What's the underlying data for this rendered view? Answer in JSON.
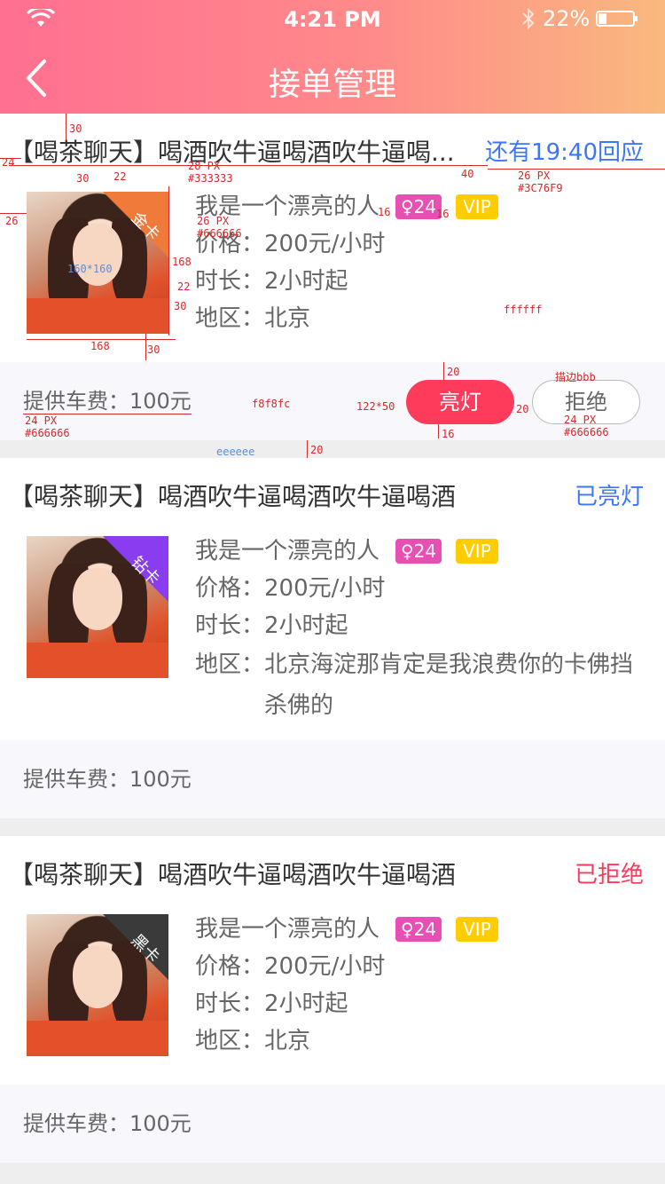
{
  "status_bar": {
    "time": "4:21 PM",
    "battery": "22%",
    "icons": [
      "wifi-icon",
      "bluetooth-icon",
      "battery-icon"
    ]
  },
  "nav": {
    "title": "接单管理",
    "back_icon": "back-icon"
  },
  "orders": [
    {
      "title": "【喝茶聊天】喝酒吹牛逼喝酒吹牛逼喝...",
      "status": "还有19:40回应",
      "status_color": "#3C76F9",
      "badge_card": "金卡",
      "name": "我是一个漂亮的人",
      "gender_age": "♀24",
      "vip": "VIP",
      "price": "价格：200元/小时",
      "duration": "时长：2小时起",
      "region": "地区：北京",
      "fare": "提供车费：100元",
      "btn_light": "亮灯",
      "btn_reject": "拒绝"
    },
    {
      "title": "【喝茶聊天】喝酒吹牛逼喝酒吹牛逼喝酒",
      "status": "已亮灯",
      "status_color": "#3C76F9",
      "badge_card": "钻卡",
      "name": "我是一个漂亮的人",
      "gender_age": "♀24",
      "vip": "VIP",
      "price": "价格：200元/小时",
      "duration": "时长：2小时起",
      "region": "地区：北京海淀那肯定是我浪费你的卡佛挡杀佛的",
      "fare": "提供车费：100元"
    },
    {
      "title": "【喝茶聊天】喝酒吹牛逼喝酒吹牛逼喝酒",
      "status": "已拒绝",
      "status_color": "#ff3b5c",
      "badge_card": "黑卡",
      "name": "我是一个漂亮的人",
      "gender_age": "♀24",
      "vip": "VIP",
      "price": "价格：200元/小时",
      "duration": "时长：2小时起",
      "region": "地区：北京",
      "fare": "提供车费：100元"
    }
  ],
  "annotations": {
    "a30_top": "30",
    "a24_left": "24",
    "a30_mid": "30",
    "a22": "22",
    "title_spec_size": "28 PX",
    "title_spec_color": "#333333",
    "a40": "40",
    "status_spec_size": "26 PX",
    "status_spec_color": "#3C76F9",
    "a26_left": "26",
    "info_spec_size": "26 PX",
    "info_spec_color": "#666666",
    "a16_a": "16",
    "a16_b": "16",
    "avatar_size": "160*160",
    "a168_right": "168",
    "a22_right": "22",
    "a30_right": "30",
    "bg_white": "ffffff",
    "a168_bottom": "168",
    "a30_bottom": "30",
    "a20_top": "20",
    "border_note": "描边bbb",
    "footer_bg": "f8f8fc",
    "btn_size": "122*50",
    "a20_gap": "20",
    "a16_bottom": "16",
    "fare_spec_size": "24 PX",
    "fare_spec_color": "#666666",
    "reject_spec_size": "24 PX",
    "reject_spec_color": "#666666",
    "gap_bg": "eeeeee",
    "a20_gap2": "20"
  }
}
